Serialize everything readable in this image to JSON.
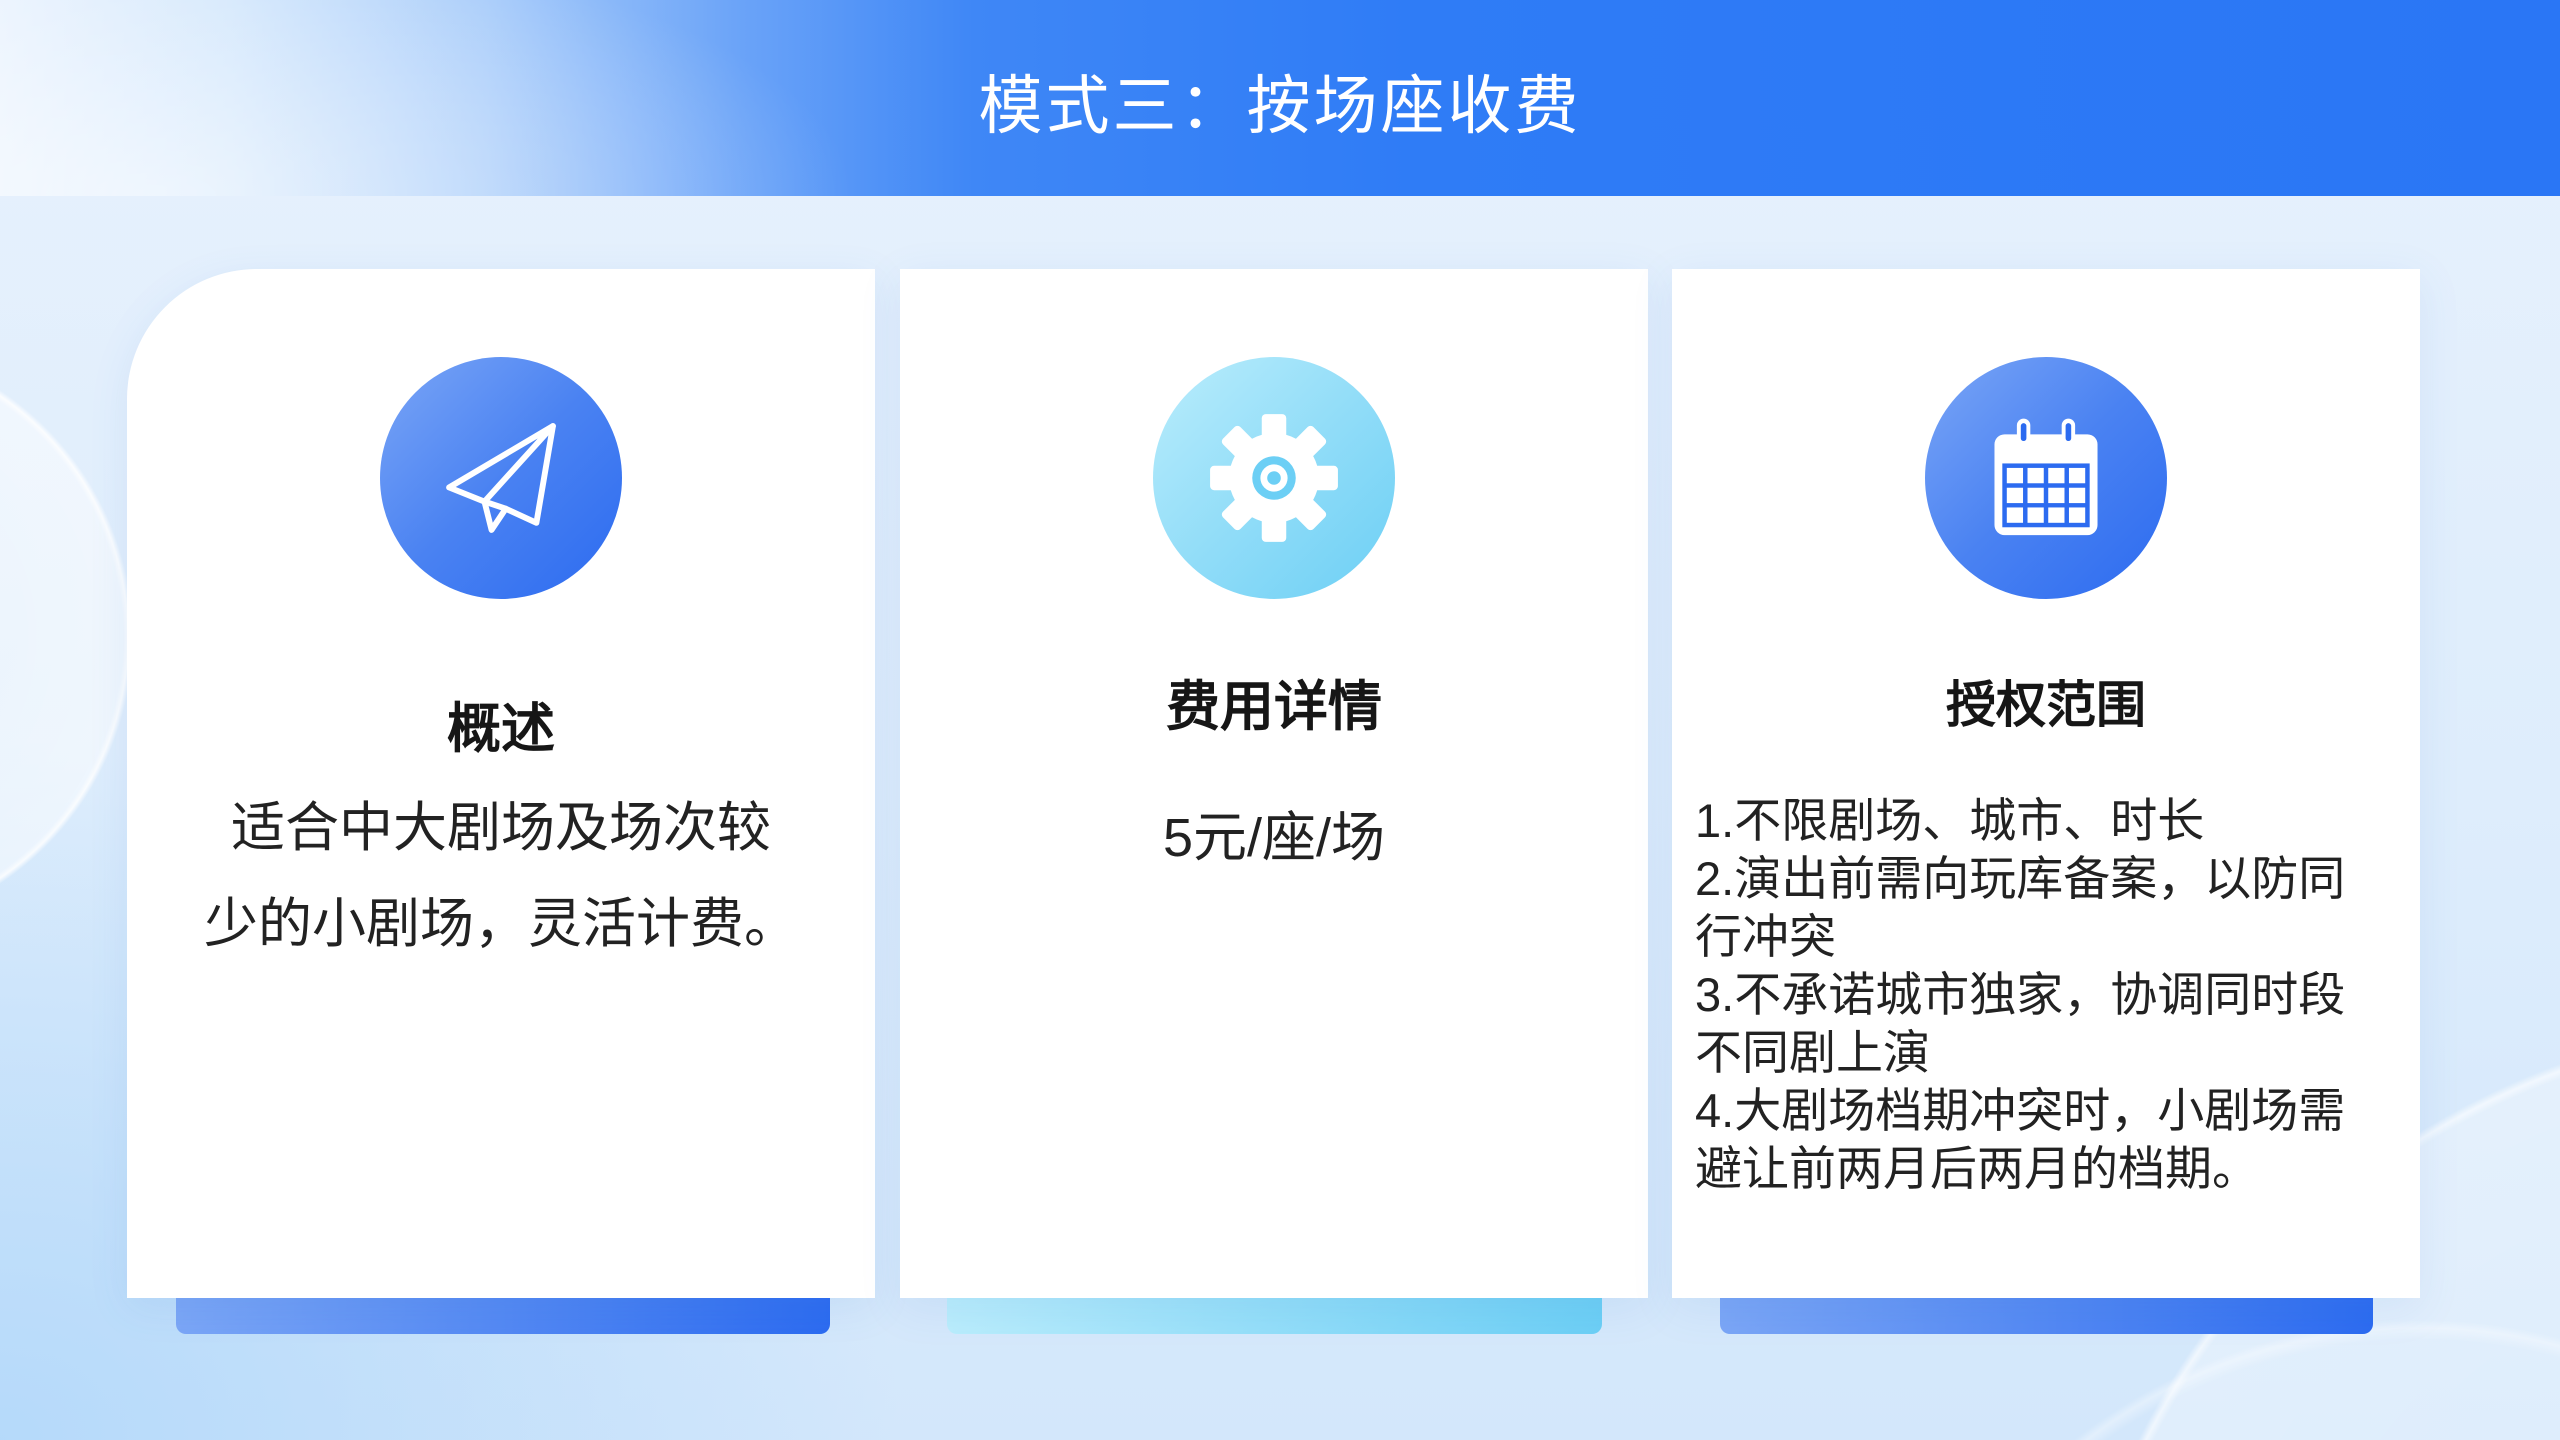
{
  "header": {
    "title": "模式三：按场座收费"
  },
  "colors": {
    "primary_blue": "#2c6bf0",
    "light_blue": "#7ba6f6",
    "cyan": "#6ccff5",
    "light_cyan": "#baedfc",
    "header_blue": "#2a76f5"
  },
  "cards": [
    {
      "icon": "paper-plane-icon",
      "title": "概述",
      "description_lines": [
        "适合中大剧场及场次较",
        "少的小剧场，灵活计费。"
      ]
    },
    {
      "icon": "gear-icon",
      "title": "费用详情",
      "value": "5元/座/场"
    },
    {
      "icon": "calendar-icon",
      "title": "授权范围",
      "items": [
        {
          "lines": [
            "1.不限剧场、城市、时长"
          ]
        },
        {
          "lines": [
            "2.演出前需向玩库备案，以防同",
            "行冲突"
          ]
        },
        {
          "lines": [
            "3.不承诺城市独家，协调同时段",
            "不同剧上演"
          ]
        },
        {
          "lines": [
            "4.大剧场档期冲突时，小剧场需",
            "避让前两月后两月的档期。"
          ]
        }
      ]
    }
  ]
}
